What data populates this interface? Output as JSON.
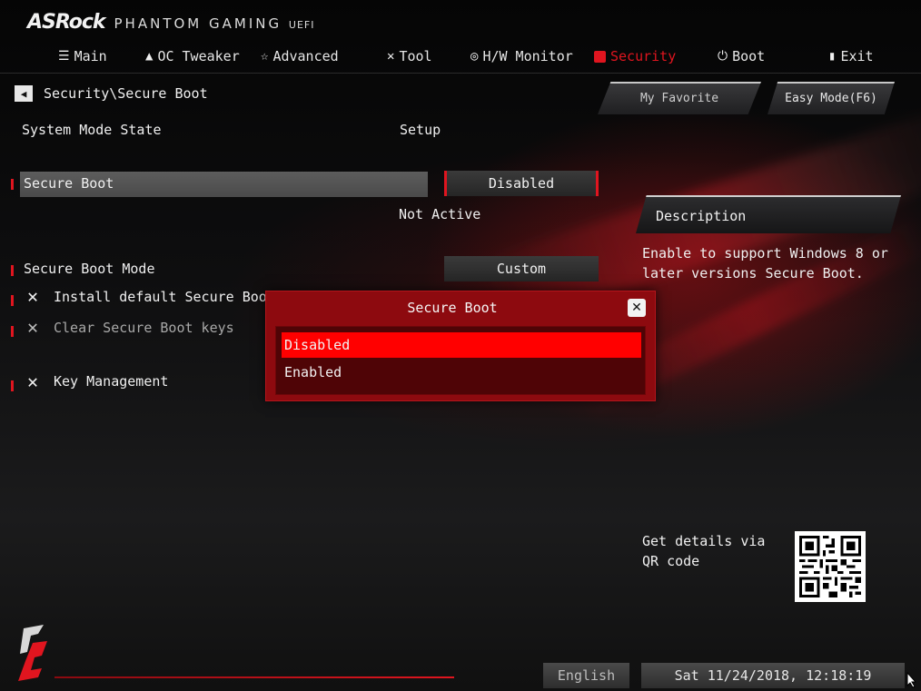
{
  "header": {
    "brand": "ASRock",
    "product": "PHANTOM GAMING",
    "product_suffix": "UEFI"
  },
  "nav": [
    {
      "label": "Main",
      "icon": "list-icon",
      "active": false
    },
    {
      "label": "OC Tweaker",
      "icon": "flame-icon",
      "active": false
    },
    {
      "label": "Advanced",
      "icon": "star-icon",
      "active": false
    },
    {
      "label": "Tool",
      "icon": "wrench-icon",
      "active": false
    },
    {
      "label": "H/W Monitor",
      "icon": "monitor-icon",
      "active": false
    },
    {
      "label": "Security",
      "icon": "shield-icon",
      "active": true
    },
    {
      "label": "Boot",
      "icon": "power-icon",
      "active": false
    },
    {
      "label": "Exit",
      "icon": "exit-icon",
      "active": false
    }
  ],
  "breadcrumb": "Security\\Secure Boot",
  "buttons": {
    "favorite": "My Favorite",
    "easy_mode": "Easy Mode(F6)"
  },
  "settings": {
    "system_mode_label": "System Mode State",
    "system_mode_value": "Setup",
    "secure_boot_label": "Secure Boot",
    "secure_boot_value": "Disabled",
    "secure_boot_status": "Not Active",
    "secure_boot_mode_label": "Secure Boot Mode",
    "secure_boot_mode_value": "Custom",
    "install_keys": "Install default Secure Boot keys",
    "clear_keys": "Clear Secure Boot keys",
    "key_management": "Key Management"
  },
  "description": {
    "title": "Description",
    "text": "Enable to support Windows 8 or later versions Secure Boot."
  },
  "qr": {
    "text": "Get details via QR code"
  },
  "dialog": {
    "title": "Secure Boot",
    "options": [
      "Disabled",
      "Enabled"
    ],
    "selected": "Disabled"
  },
  "footer": {
    "language": "English",
    "datetime": "Sat 11/24/2018, 12:18:19"
  },
  "colors": {
    "accent": "#e0151f",
    "dialog_bg": "#8d0a0f",
    "selection": "#ff0000"
  }
}
